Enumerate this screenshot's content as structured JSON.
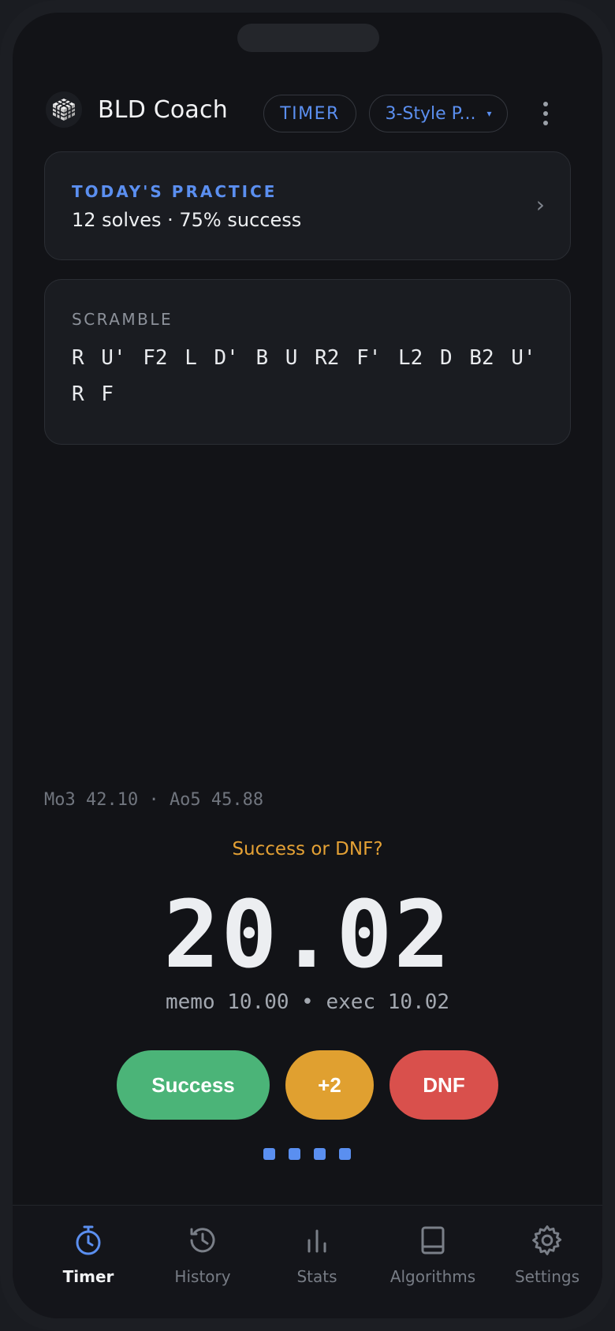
{
  "app": {
    "title": "BLD Coach",
    "mode_pill": "TIMER",
    "method_select": "3-Style P...",
    "method_caret": "▾"
  },
  "colors": {
    "accent": "#5b8ff0",
    "success": "#4bb478",
    "plus2": "#e0a030",
    "dnf": "#d9504c",
    "prompt": "#e4a135",
    "background": "#121317"
  },
  "practice": {
    "label": "TODAY'S PRACTICE",
    "summary": "12 solves · 75% success",
    "chevron": "›"
  },
  "scramble": {
    "label": "SCRAMBLE",
    "moves": "R U' F2 L D' B U R2 F' L2 D B2 U' R F"
  },
  "timer": {
    "averages": "Mo3 42.10 · Ao5 45.88",
    "prompt": "Success or DNF?",
    "time": "20.02",
    "split": "memo 10.00 • exec 10.02"
  },
  "actions": {
    "success": "Success",
    "plus2": "+2",
    "dnf": "DNF"
  },
  "pager": {
    "count": 4
  },
  "nav": {
    "items": [
      {
        "label": "Timer",
        "icon": "stopwatch-icon",
        "active": true
      },
      {
        "label": "History",
        "icon": "history-icon",
        "active": false
      },
      {
        "label": "Stats",
        "icon": "bar-chart-icon",
        "active": false
      },
      {
        "label": "Algorithms",
        "icon": "book-icon",
        "active": false
      },
      {
        "label": "Settings",
        "icon": "gear-icon",
        "active": false
      }
    ]
  }
}
